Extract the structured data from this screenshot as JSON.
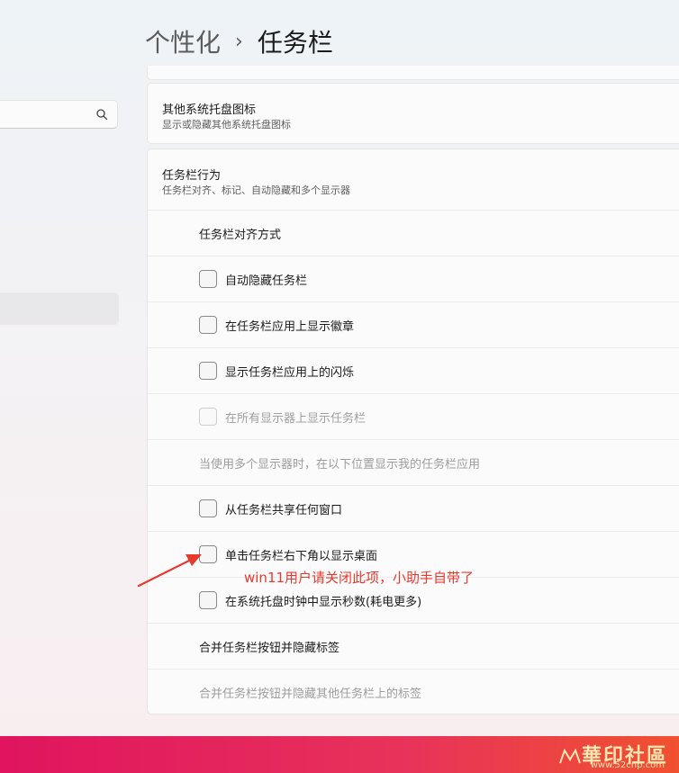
{
  "breadcrumb": {
    "parent": "个性化",
    "separator": "›",
    "current": "任务栏"
  },
  "search": {
    "value": "",
    "placeholder": "",
    "icon": "search-icon"
  },
  "tray_card": {
    "title": "其他系统托盘图标",
    "description": "显示或隐藏其他系统托盘图标"
  },
  "behavior_card": {
    "title": "任务栏行为",
    "description": "任务栏对齐、标记、自动隐藏和多个显示器",
    "rows": [
      {
        "type": "plain",
        "label": "任务栏对齐方式"
      },
      {
        "type": "checkbox",
        "label": "自动隐藏任务栏",
        "checked": false,
        "enabled": true
      },
      {
        "type": "checkbox",
        "label": "在任务栏应用上显示徽章",
        "checked": false,
        "enabled": true
      },
      {
        "type": "checkbox",
        "label": "显示任务栏应用上的闪烁",
        "checked": false,
        "enabled": true
      },
      {
        "type": "checkbox",
        "label": "在所有显示器上显示任务栏",
        "checked": false,
        "enabled": false
      },
      {
        "type": "caption",
        "label": "当使用多个显示器时，在以下位置显示我的任务栏应用"
      },
      {
        "type": "checkbox",
        "label": "从任务栏共享任何窗口",
        "checked": false,
        "enabled": true
      },
      {
        "type": "checkbox",
        "label": "单击任务栏右下角以显示桌面",
        "checked": false,
        "enabled": true
      },
      {
        "type": "checkbox",
        "label": "在系统托盘时钟中显示秒数(耗电更多)",
        "checked": false,
        "enabled": true
      },
      {
        "type": "plain",
        "label": "合并任务栏按钮并隐藏标签"
      },
      {
        "type": "caption",
        "label": "合并任务栏按钮并隐藏其他任务栏上的标签"
      }
    ]
  },
  "annotation": {
    "text": "win11用户请关闭此项，小助手自带了",
    "color": "#e8392f"
  },
  "watermark": {
    "text": "華印社區",
    "url": "www.52cnp.com"
  },
  "colors": {
    "accent_bar_start": "#e0145f",
    "accent_bar_end": "#f0512f"
  }
}
